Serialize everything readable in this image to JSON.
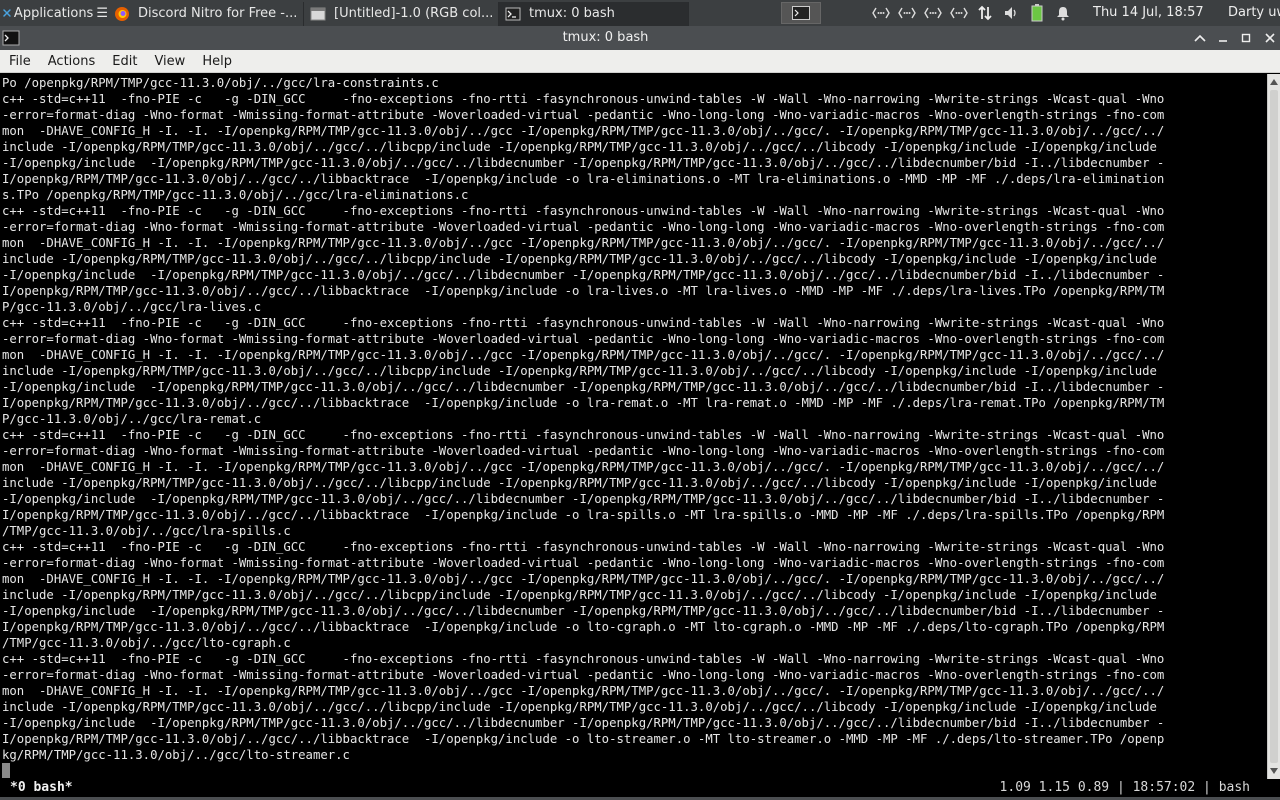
{
  "panel": {
    "apps_label": "Applications",
    "tasks": [
      {
        "label": "Discord Nitro for Free -..."
      },
      {
        "label": "[Untitled]-1.0 (RGB col..."
      },
      {
        "label": "tmux: 0 bash"
      }
    ],
    "clock": "Thu 14 Jul, 18:57",
    "user": "Darty uwu"
  },
  "window": {
    "title": "tmux: 0 bash"
  },
  "menu": {
    "file": "File",
    "actions": "Actions",
    "edit": "Edit",
    "view": "View",
    "help": "Help"
  },
  "terminal": {
    "lines": [
      "Po /openpkg/RPM/TMP/gcc-11.3.0/obj/../gcc/lra-constraints.c",
      "c++ -std=c++11  -fno-PIE -c   -g -DIN_GCC     -fno-exceptions -fno-rtti -fasynchronous-unwind-tables -W -Wall -Wno-narrowing -Wwrite-strings -Wcast-qual -Wno",
      "-error=format-diag -Wno-format -Wmissing-format-attribute -Woverloaded-virtual -pedantic -Wno-long-long -Wno-variadic-macros -Wno-overlength-strings -fno-com",
      "mon  -DHAVE_CONFIG_H -I. -I. -I/openpkg/RPM/TMP/gcc-11.3.0/obj/../gcc -I/openpkg/RPM/TMP/gcc-11.3.0/obj/../gcc/. -I/openpkg/RPM/TMP/gcc-11.3.0/obj/../gcc/../",
      "include -I/openpkg/RPM/TMP/gcc-11.3.0/obj/../gcc/../libcpp/include -I/openpkg/RPM/TMP/gcc-11.3.0/obj/../gcc/../libcody -I/openpkg/include -I/openpkg/include",
      "-I/openpkg/include  -I/openpkg/RPM/TMP/gcc-11.3.0/obj/../gcc/../libdecnumber -I/openpkg/RPM/TMP/gcc-11.3.0/obj/../gcc/../libdecnumber/bid -I../libdecnumber -",
      "I/openpkg/RPM/TMP/gcc-11.3.0/obj/../gcc/../libbacktrace  -I/openpkg/include -o lra-eliminations.o -MT lra-eliminations.o -MMD -MP -MF ./.deps/lra-elimination",
      "s.TPo /openpkg/RPM/TMP/gcc-11.3.0/obj/../gcc/lra-eliminations.c",
      "c++ -std=c++11  -fno-PIE -c   -g -DIN_GCC     -fno-exceptions -fno-rtti -fasynchronous-unwind-tables -W -Wall -Wno-narrowing -Wwrite-strings -Wcast-qual -Wno",
      "-error=format-diag -Wno-format -Wmissing-format-attribute -Woverloaded-virtual -pedantic -Wno-long-long -Wno-variadic-macros -Wno-overlength-strings -fno-com",
      "mon  -DHAVE_CONFIG_H -I. -I. -I/openpkg/RPM/TMP/gcc-11.3.0/obj/../gcc -I/openpkg/RPM/TMP/gcc-11.3.0/obj/../gcc/. -I/openpkg/RPM/TMP/gcc-11.3.0/obj/../gcc/../",
      "include -I/openpkg/RPM/TMP/gcc-11.3.0/obj/../gcc/../libcpp/include -I/openpkg/RPM/TMP/gcc-11.3.0/obj/../gcc/../libcody -I/openpkg/include -I/openpkg/include",
      "-I/openpkg/include  -I/openpkg/RPM/TMP/gcc-11.3.0/obj/../gcc/../libdecnumber -I/openpkg/RPM/TMP/gcc-11.3.0/obj/../gcc/../libdecnumber/bid -I../libdecnumber -",
      "I/openpkg/RPM/TMP/gcc-11.3.0/obj/../gcc/../libbacktrace  -I/openpkg/include -o lra-lives.o -MT lra-lives.o -MMD -MP -MF ./.deps/lra-lives.TPo /openpkg/RPM/TM",
      "P/gcc-11.3.0/obj/../gcc/lra-lives.c",
      "c++ -std=c++11  -fno-PIE -c   -g -DIN_GCC     -fno-exceptions -fno-rtti -fasynchronous-unwind-tables -W -Wall -Wno-narrowing -Wwrite-strings -Wcast-qual -Wno",
      "-error=format-diag -Wno-format -Wmissing-format-attribute -Woverloaded-virtual -pedantic -Wno-long-long -Wno-variadic-macros -Wno-overlength-strings -fno-com",
      "mon  -DHAVE_CONFIG_H -I. -I. -I/openpkg/RPM/TMP/gcc-11.3.0/obj/../gcc -I/openpkg/RPM/TMP/gcc-11.3.0/obj/../gcc/. -I/openpkg/RPM/TMP/gcc-11.3.0/obj/../gcc/../",
      "include -I/openpkg/RPM/TMP/gcc-11.3.0/obj/../gcc/../libcpp/include -I/openpkg/RPM/TMP/gcc-11.3.0/obj/../gcc/../libcody -I/openpkg/include -I/openpkg/include",
      "-I/openpkg/include  -I/openpkg/RPM/TMP/gcc-11.3.0/obj/../gcc/../libdecnumber -I/openpkg/RPM/TMP/gcc-11.3.0/obj/../gcc/../libdecnumber/bid -I../libdecnumber -",
      "I/openpkg/RPM/TMP/gcc-11.3.0/obj/../gcc/../libbacktrace  -I/openpkg/include -o lra-remat.o -MT lra-remat.o -MMD -MP -MF ./.deps/lra-remat.TPo /openpkg/RPM/TM",
      "P/gcc-11.3.0/obj/../gcc/lra-remat.c",
      "c++ -std=c++11  -fno-PIE -c   -g -DIN_GCC     -fno-exceptions -fno-rtti -fasynchronous-unwind-tables -W -Wall -Wno-narrowing -Wwrite-strings -Wcast-qual -Wno",
      "-error=format-diag -Wno-format -Wmissing-format-attribute -Woverloaded-virtual -pedantic -Wno-long-long -Wno-variadic-macros -Wno-overlength-strings -fno-com",
      "mon  -DHAVE_CONFIG_H -I. -I. -I/openpkg/RPM/TMP/gcc-11.3.0/obj/../gcc -I/openpkg/RPM/TMP/gcc-11.3.0/obj/../gcc/. -I/openpkg/RPM/TMP/gcc-11.3.0/obj/../gcc/../",
      "include -I/openpkg/RPM/TMP/gcc-11.3.0/obj/../gcc/../libcpp/include -I/openpkg/RPM/TMP/gcc-11.3.0/obj/../gcc/../libcody -I/openpkg/include -I/openpkg/include",
      "-I/openpkg/include  -I/openpkg/RPM/TMP/gcc-11.3.0/obj/../gcc/../libdecnumber -I/openpkg/RPM/TMP/gcc-11.3.0/obj/../gcc/../libdecnumber/bid -I../libdecnumber -",
      "I/openpkg/RPM/TMP/gcc-11.3.0/obj/../gcc/../libbacktrace  -I/openpkg/include -o lra-spills.o -MT lra-spills.o -MMD -MP -MF ./.deps/lra-spills.TPo /openpkg/RPM",
      "/TMP/gcc-11.3.0/obj/../gcc/lra-spills.c",
      "c++ -std=c++11  -fno-PIE -c   -g -DIN_GCC     -fno-exceptions -fno-rtti -fasynchronous-unwind-tables -W -Wall -Wno-narrowing -Wwrite-strings -Wcast-qual -Wno",
      "-error=format-diag -Wno-format -Wmissing-format-attribute -Woverloaded-virtual -pedantic -Wno-long-long -Wno-variadic-macros -Wno-overlength-strings -fno-com",
      "mon  -DHAVE_CONFIG_H -I. -I. -I/openpkg/RPM/TMP/gcc-11.3.0/obj/../gcc -I/openpkg/RPM/TMP/gcc-11.3.0/obj/../gcc/. -I/openpkg/RPM/TMP/gcc-11.3.0/obj/../gcc/../",
      "include -I/openpkg/RPM/TMP/gcc-11.3.0/obj/../gcc/../libcpp/include -I/openpkg/RPM/TMP/gcc-11.3.0/obj/../gcc/../libcody -I/openpkg/include -I/openpkg/include",
      "-I/openpkg/include  -I/openpkg/RPM/TMP/gcc-11.3.0/obj/../gcc/../libdecnumber -I/openpkg/RPM/TMP/gcc-11.3.0/obj/../gcc/../libdecnumber/bid -I../libdecnumber -",
      "I/openpkg/RPM/TMP/gcc-11.3.0/obj/../gcc/../libbacktrace  -I/openpkg/include -o lto-cgraph.o -MT lto-cgraph.o -MMD -MP -MF ./.deps/lto-cgraph.TPo /openpkg/RPM",
      "/TMP/gcc-11.3.0/obj/../gcc/lto-cgraph.c",
      "c++ -std=c++11  -fno-PIE -c   -g -DIN_GCC     -fno-exceptions -fno-rtti -fasynchronous-unwind-tables -W -Wall -Wno-narrowing -Wwrite-strings -Wcast-qual -Wno",
      "-error=format-diag -Wno-format -Wmissing-format-attribute -Woverloaded-virtual -pedantic -Wno-long-long -Wno-variadic-macros -Wno-overlength-strings -fno-com",
      "mon  -DHAVE_CONFIG_H -I. -I. -I/openpkg/RPM/TMP/gcc-11.3.0/obj/../gcc -I/openpkg/RPM/TMP/gcc-11.3.0/obj/../gcc/. -I/openpkg/RPM/TMP/gcc-11.3.0/obj/../gcc/../",
      "include -I/openpkg/RPM/TMP/gcc-11.3.0/obj/../gcc/../libcpp/include -I/openpkg/RPM/TMP/gcc-11.3.0/obj/../gcc/../libcody -I/openpkg/include -I/openpkg/include",
      "-I/openpkg/include  -I/openpkg/RPM/TMP/gcc-11.3.0/obj/../gcc/../libdecnumber -I/openpkg/RPM/TMP/gcc-11.3.0/obj/../gcc/../libdecnumber/bid -I../libdecnumber -",
      "I/openpkg/RPM/TMP/gcc-11.3.0/obj/../gcc/../libbacktrace  -I/openpkg/include -o lto-streamer.o -MT lto-streamer.o -MMD -MP -MF ./.deps/lto-streamer.TPo /openp",
      "kg/RPM/TMP/gcc-11.3.0/obj/../gcc/lto-streamer.c"
    ]
  },
  "tmux": {
    "window_label": "*0 bash*",
    "status_right": "1.09 1.15 0.89 | 18:57:02 | bash"
  },
  "icons": {
    "apps": "xfce-logo-icon",
    "discord_task": "firefox-icon",
    "gimp_task": "gimp-window-icon",
    "tmux_task": "terminal-icon",
    "window": "terminal-icon",
    "tray": [
      "network-icon",
      "network-icon",
      "network-icon",
      "network-icon",
      "transfer-icon",
      "volume-icon",
      "battery-icon",
      "bell-icon"
    ]
  },
  "colors": {
    "panel_bg": "#3c3f41",
    "terminal_bg": "#000000",
    "terminal_fg": "#e6e6e6",
    "battery": "#6cc644"
  }
}
